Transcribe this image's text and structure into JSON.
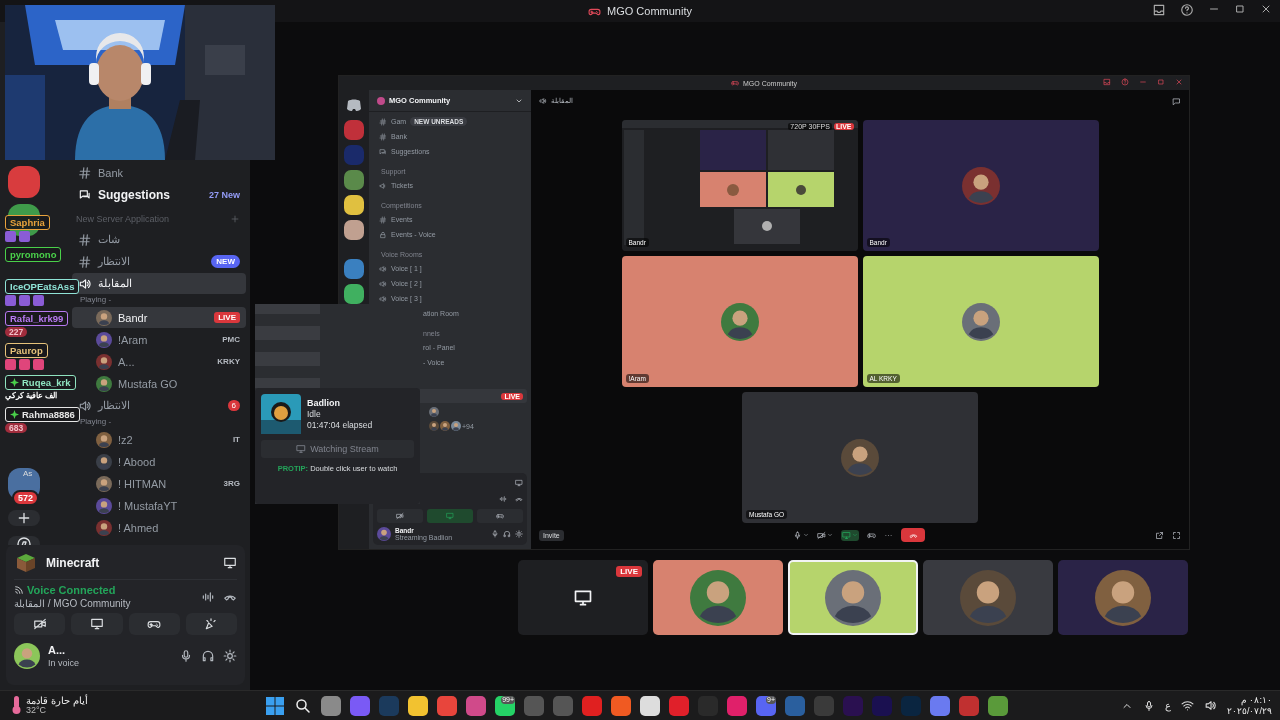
{
  "window": {
    "title": "MGO Community"
  },
  "webcam": {
    "kind": "picture"
  },
  "servers": [
    {
      "kind": "picture"
    },
    {
      "kind": "picture"
    },
    {
      "kind": "picture",
      "label": "As",
      "badge": "572"
    }
  ],
  "channels": [
    {
      "kind": "text",
      "name": "Bank",
      "selected": false
    },
    {
      "kind": "forum",
      "name": "Suggestions",
      "count": "27 New",
      "selected": false
    },
    {
      "kind": "category",
      "name": "New Server Application"
    },
    {
      "kind": "text",
      "name": "شات",
      "selected": false
    },
    {
      "kind": "text",
      "name": "الانتظار",
      "badge": "NEW",
      "selected": false
    },
    {
      "kind": "voice",
      "name": "المقابلة",
      "selected": true
    },
    {
      "kind": "activity",
      "name": "Playing -"
    },
    {
      "kind": "user",
      "name": "Bandr",
      "live_badge": "LIVE",
      "selected": true
    },
    {
      "kind": "user",
      "name": "!Aram",
      "tag": "PMC",
      "selected": false
    },
    {
      "kind": "user",
      "name": "A...",
      "tag": "KRKY",
      "selected": false
    },
    {
      "kind": "user",
      "name": "Mustafa GO",
      "selected": false
    },
    {
      "kind": "voice",
      "name": "الانتظار",
      "badge": "6",
      "selected": false
    },
    {
      "kind": "activity",
      "name": "Playing -"
    },
    {
      "kind": "user",
      "name": "!z2",
      "tag": "IT",
      "selected": false
    },
    {
      "kind": "user",
      "name": "! Abood",
      "selected": false
    },
    {
      "kind": "user",
      "name": "! HITMAN",
      "tag": "3RG",
      "selected": false
    },
    {
      "kind": "user",
      "name": "! MustafaYT",
      "selected": false
    },
    {
      "kind": "user",
      "name": "! Ahmed",
      "selected": false
    }
  ],
  "chat_overlay": [
    {
      "name": "Saphria",
      "color": "#e8a23c",
      "subscriber": false,
      "emotes": [
        {
          "color": "#8a5cd6"
        },
        {
          "color": "#8a5cd6"
        }
      ]
    },
    {
      "name": "pyromono",
      "color": "#4ad04a",
      "subscriber": false
    },
    {
      "name": "IceOPEatsAss",
      "color": "#8fe3d6",
      "subscriber": false,
      "emotes": [
        {
          "color": "#8a5cd6"
        },
        {
          "color": "#8a5cd6"
        },
        {
          "color": "#8a5cd6"
        }
      ]
    },
    {
      "name": "Rafal_krk99",
      "color": "#b779f0",
      "subscriber": false,
      "count": "227"
    },
    {
      "name": "Paurop",
      "color": "#e6c27a",
      "subscriber": false,
      "emotes": [
        {
          "color": "#e0457b"
        },
        {
          "color": "#e0457b"
        },
        {
          "color": "#e0457b"
        }
      ]
    },
    {
      "name": "Ruqea_krk",
      "color": "#8fe3c0",
      "subscriber": true,
      "message": "الف عافية كركي"
    },
    {
      "name": "Rahma8886",
      "color": "#e6e6e6",
      "subscriber": true,
      "count": "683"
    }
  ],
  "panel": {
    "activity": "Minecraft",
    "voice_status": "Voice Connected",
    "voice_channel": "المقابلة / MGO Community",
    "user": {
      "name": "A...",
      "status": "In voice"
    }
  },
  "popup": {
    "game": "Badlion",
    "status": "Idle",
    "elapsed": "01:47:04 elapsed",
    "button": "Watching Stream",
    "tip": "**PROTIP:** Double click user to watch"
  },
  "inner": {
    "title": "MGO Community",
    "server": "MGO Community",
    "new_unreads": "NEW UNREADS",
    "channels": [
      {
        "kind": "text",
        "name": "Gam"
      },
      {
        "kind": "text",
        "name": "Bank"
      },
      {
        "kind": "forum",
        "name": "Suggestions"
      },
      {
        "kind": "category",
        "name": "Support"
      },
      {
        "kind": "announcement",
        "name": "Tickets"
      },
      {
        "kind": "category",
        "name": "Competitions"
      },
      {
        "kind": "text",
        "name": "Events"
      },
      {
        "kind": "locked",
        "name": "Events - Voice"
      },
      {
        "kind": "category",
        "name": "Voice Rooms"
      },
      {
        "kind": "voice",
        "name": "Voice [ 1 ]"
      },
      {
        "kind": "voice",
        "name": "Voice [ 2 ]"
      },
      {
        "kind": "voice",
        "name": "Voice [ 3 ]"
      },
      {
        "kind": "fragment",
        "name": "ation Room"
      },
      {
        "kind": "fragment_category",
        "name": "nnels"
      },
      {
        "kind": "fragment",
        "name": "rol - Panel"
      },
      {
        "kind": "fragment",
        "name": "- Voice"
      }
    ],
    "live_badge": "LIVE",
    "extra_count": "+94",
    "header": "المقابلة",
    "tiles": [
      {
        "kind": "screen",
        "name": "Bandr",
        "quality": "720P 30FPS",
        "live_badge": "LIVE"
      },
      {
        "kind": "avatar",
        "name": "Bandr",
        "color": "#2a2347"
      },
      {
        "kind": "avatar",
        "name": "!Aram",
        "color": "#d7826f"
      },
      {
        "kind": "avatar",
        "name": "AL KRKY",
        "color": "#b6d46c"
      },
      {
        "kind": "avatar",
        "name": "Mustafa GO",
        "color": "#2f3035"
      }
    ],
    "user": {
      "name": "Bandr",
      "status": "Streaming Badlion"
    },
    "invite": "Invite"
  },
  "strip": [
    {
      "kind": "screen",
      "live_badge": "LIVE",
      "selected": false
    },
    {
      "kind": "avatar",
      "color": "#d7826f",
      "selected": false
    },
    {
      "kind": "avatar",
      "color": "#b6d46c",
      "selected": true
    },
    {
      "kind": "avatar",
      "color": "#393a40",
      "selected": false
    },
    {
      "kind": "avatar",
      "color": "#2a2347",
      "selected": false
    }
  ],
  "weather": {
    "condition": "أيام حارة قادمة",
    "temperature": "32°C"
  },
  "taskbar": {
    "apps": [
      {
        "color": "#8a8a8a"
      },
      {
        "color": "#7a5af5"
      },
      {
        "color": "#1b3a5c"
      },
      {
        "color": "#f2c230"
      },
      {
        "color": "#e8453c"
      },
      {
        "color": "#d04a8a"
      },
      {
        "color": "#25d366",
        "badge": "99+"
      },
      {
        "color": "#555555"
      },
      {
        "color": "#555555"
      },
      {
        "color": "#e02020"
      },
      {
        "color": "#f05a22"
      },
      {
        "color": "#dddddd"
      },
      {
        "color": "#e0202a"
      },
      {
        "color": "#2a2a2a"
      },
      {
        "color": "#e0206a"
      },
      {
        "color": "#5865f2",
        "badge": "9+"
      },
      {
        "color": "#2a5f9e"
      },
      {
        "color": "#3a3a3a"
      },
      {
        "color": "#2a1050"
      },
      {
        "color": "#1a1050"
      },
      {
        "color": "#0a2540"
      },
      {
        "color": "#6a7af0"
      },
      {
        "color": "#c03030"
      },
      {
        "color": "#5a9a3a"
      }
    ],
    "language": "ع",
    "time": "٠٨:١٠ م",
    "date": "٢٠٢٥/٠٧/٢٩"
  }
}
